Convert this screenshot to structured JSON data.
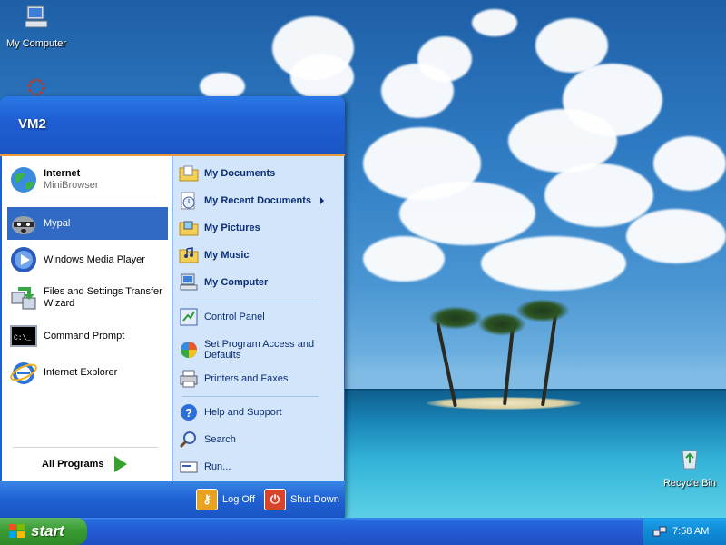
{
  "desktop": {
    "icons": [
      {
        "label": "My Computer",
        "icon": "my-computer-icon"
      },
      {
        "label": "",
        "icon": "network-icon"
      },
      {
        "label": "Recycle Bin",
        "icon": "recycle-bin-icon"
      }
    ]
  },
  "start_menu": {
    "user_name": "VM2",
    "left_items": [
      {
        "title": "Internet",
        "subtitle": "MiniBrowser",
        "icon": "internet-globe-icon"
      },
      {
        "title": "Mypal",
        "subtitle": "",
        "icon": "mypal-raccoon-icon"
      },
      {
        "title": "Windows Media Player",
        "subtitle": "",
        "icon": "media-player-icon"
      },
      {
        "title": "Files and Settings Transfer Wizard",
        "subtitle": "",
        "icon": "transfer-wizard-icon"
      },
      {
        "title": "Command Prompt",
        "subtitle": "",
        "icon": "command-prompt-icon"
      },
      {
        "title": "Internet Explorer",
        "subtitle": "",
        "icon": "internet-explorer-icon"
      }
    ],
    "all_programs": "All Programs",
    "right_items": [
      {
        "label": "My Documents",
        "icon": "my-documents-folder-icon"
      },
      {
        "label": "My Recent Documents",
        "icon": "recent-documents-icon"
      },
      {
        "label": "My Pictures",
        "icon": "my-pictures-folder-icon"
      },
      {
        "label": "My Music",
        "icon": "my-music-folder-icon"
      },
      {
        "label": "My Computer",
        "icon": "my-computer-icon"
      },
      {
        "label": "Control Panel",
        "icon": "control-panel-icon"
      },
      {
        "label": "Set Program Access and Defaults",
        "icon": "program-defaults-icon"
      },
      {
        "label": "Printers and Faxes",
        "icon": "printer-icon"
      },
      {
        "label": "Help and Support",
        "icon": "help-icon"
      },
      {
        "label": "Search",
        "icon": "search-icon"
      },
      {
        "label": "Run...",
        "icon": "run-icon"
      }
    ],
    "log_off": "Log Off",
    "shut_down": "Shut Down"
  },
  "taskbar": {
    "start_label": "start",
    "clock": "7:58 AM"
  },
  "colors": {
    "selection": "#316ac5",
    "header_blue": "#1f5fd3",
    "right_pane": "#d3e5fa",
    "start_green": "#3b9b33",
    "tray_blue": "#0f8bd8"
  }
}
